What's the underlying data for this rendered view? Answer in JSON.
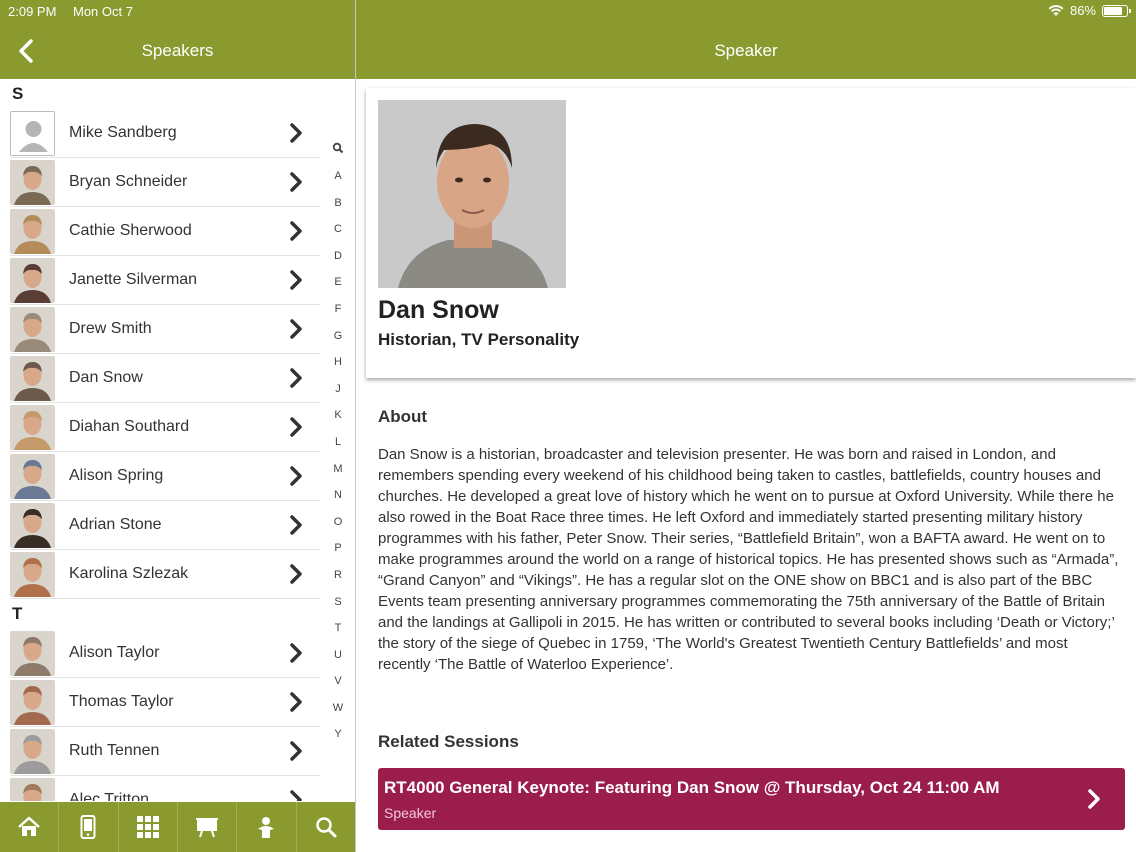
{
  "status_bar": {
    "time": "2:09 PM",
    "date": "Mon Oct 7",
    "battery": "86%"
  },
  "left_header": {
    "title": "Speakers"
  },
  "right_header": {
    "title": "Speaker"
  },
  "sections": [
    {
      "letter": "S",
      "speakers": [
        "Mike Sandberg",
        "Bryan Schneider",
        "Cathie Sherwood",
        "Janette Silverman",
        "Drew Smith",
        "Dan Snow",
        "Diahan Southard",
        "Alison Spring",
        "Adrian Stone",
        "Karolina Szlezak"
      ]
    },
    {
      "letter": "T",
      "speakers": [
        "Alison Taylor",
        "Thomas Taylor",
        "Ruth Tennen",
        "Alec Tritton"
      ]
    }
  ],
  "index_letters": [
    "A",
    "B",
    "C",
    "D",
    "E",
    "F",
    "G",
    "H",
    "J",
    "K",
    "L",
    "M",
    "N",
    "O",
    "P",
    "R",
    "S",
    "T",
    "U",
    "V",
    "W",
    "Y"
  ],
  "tabs": [
    "home-icon",
    "mobile-icon",
    "grid-icon",
    "presentation-icon",
    "speaker-icon",
    "search-icon"
  ],
  "speaker": {
    "name": "Dan Snow",
    "role": "Historian, TV Personality",
    "about_heading": "About",
    "about": "Dan Snow is a historian, broadcaster and television presenter. He was born and raised in London, and remembers spending every weekend of his childhood being taken to castles, battlefields, country houses and churches. He developed a great love of history which he went on to pursue at Oxford University. While there he also rowed in the Boat Race three times. He left Oxford and immediately started presenting military history programmes with his father, Peter Snow. Their series, “Battlefield Britain”, won a BAFTA award. He went on to make programmes around the world on a range of historical topics. He has presented shows such as “Armada”, “Grand Canyon” and “Vikings”. He has a regular slot on the ONE show on BBC1 and is also part of the BBC Events team presenting anniversary programmes commemorating the 75th anniversary of the Battle of Britain and the landings at Gallipoli in 2015. He has written or contributed to several books including ‘Death or Victory;’ the story of the siege of Quebec in 1759, ‘The World's Greatest Twentieth Century Battlefields’ and most recently ‘The Battle of Waterloo Experience’.",
    "related_heading": "Related Sessions",
    "sessions": [
      {
        "title": "RT4000 General Keynote: Featuring Dan Snow @ Thursday, Oct 24 11:00 AM",
        "role": "Speaker"
      }
    ]
  },
  "colors": {
    "header": "#8a9a2e",
    "session": "#9b1d4c"
  }
}
